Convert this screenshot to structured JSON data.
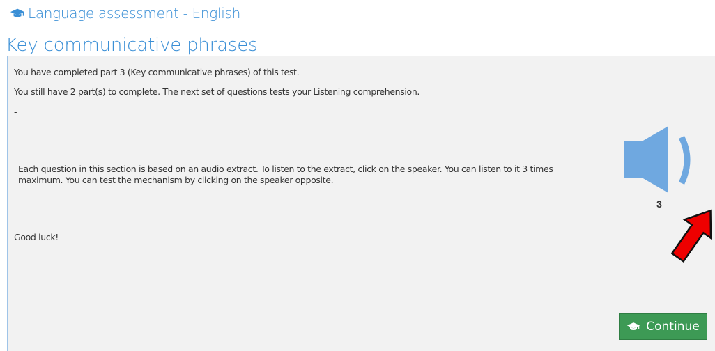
{
  "header": {
    "app_title": "Language assessment - English",
    "icon": "graduation-cap-icon"
  },
  "section": {
    "title": "Key communicative phrases"
  },
  "panel": {
    "completed_text": "You have completed part 3 (Key communicative phrases) of this test.",
    "remaining_text": "You still have 2 part(s) to complete. The next set of questions tests your Listening comprehension.",
    "separator_text": "-",
    "instructions_text": "Each question in this section is based on an audio extract. To listen to the extract, click on the speaker. You can listen to it 3 times maximum. You can test the mechanism by clicking on the speaker opposite.",
    "good_luck_text": "Good luck!"
  },
  "audio": {
    "icon": "speaker-icon",
    "plays_remaining": "3"
  },
  "annotation": {
    "icon": "red-arrow-icon"
  },
  "actions": {
    "continue_label": "Continue",
    "continue_icon": "graduation-cap-icon"
  },
  "colors": {
    "accent_blue": "#3a8fd6",
    "panel_bg": "#f2f2f2",
    "speaker_blue": "#6fa8e0",
    "button_green": "#3d9a55",
    "arrow_red": "#ee0000"
  }
}
